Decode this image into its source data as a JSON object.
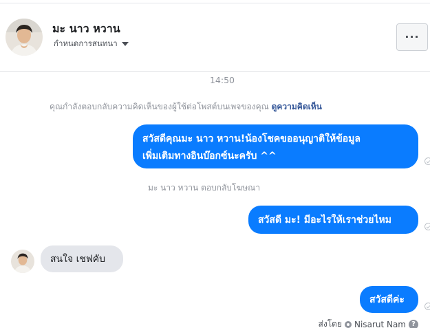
{
  "header": {
    "contact_name": "มะ นาว หวาน",
    "conversation_settings_label": "กำหนดการสนทนา",
    "more_label": "···"
  },
  "thread": {
    "timestamp": "14:50",
    "system_notice": "คุณกำลังตอบกลับความคิดเห็นของผู้ใช้ต่อโพสต์บนเพจของคุณ",
    "view_comment_link": "ดูความคิดเห็น",
    "ad_reply_notice": "มะ นาว หวาน ตอบกลับโฆษณา",
    "messages": [
      {
        "sender": "page",
        "lines": [
          "สวัสดีคุณมะ นาว หวาน!น้องโชคขออนุญาติให้ข้อมูล",
          "เพิ่มเติมทางอินบ๊อกซ์นะครับ ^^"
        ]
      },
      {
        "sender": "page",
        "text": "สวัสดี มะ! มีอะไรให้เราช่วยไหม"
      },
      {
        "sender": "contact",
        "text": "สนใจ เชฟคับ"
      },
      {
        "sender": "page",
        "text": "สวัสดีค่ะ"
      }
    ],
    "sent_by_label": "ส่งโดย",
    "sent_by_name": "Nisarut Nam",
    "help_label": "?"
  },
  "colors": {
    "outgoing_bubble": "#0a7cff",
    "incoming_bubble": "#e4e6eb",
    "link": "#365899"
  },
  "icons": {
    "more": "more-horizontal-icon",
    "dropdown": "caret-down-icon",
    "delivered": "check-circle-icon",
    "help": "question-circle-icon"
  }
}
